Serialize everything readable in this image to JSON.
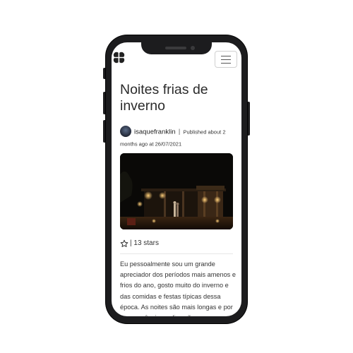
{
  "post": {
    "title": "Noites frias de inverno",
    "author": "isaquefranklin",
    "separator": "|",
    "published": "Published about 2 months ago at 26/07/2021",
    "stars_label": "| 13 stars",
    "body": "Eu pessoalmente sou um grande apreciador dos períodos mais amenos e frios do ano, gosto muito do inverno e das comidas e festas típicas dessa época. As noites são mais longas e por consequência os dias são"
  },
  "icons": {
    "logo": "clover-logo-icon",
    "menu": "hamburger-menu-icon",
    "star": "star-outline-icon"
  },
  "colors": {
    "phone_frame": "#1c1c1e",
    "text": "#2b2b2b",
    "image_bg": "#0b0a08"
  }
}
